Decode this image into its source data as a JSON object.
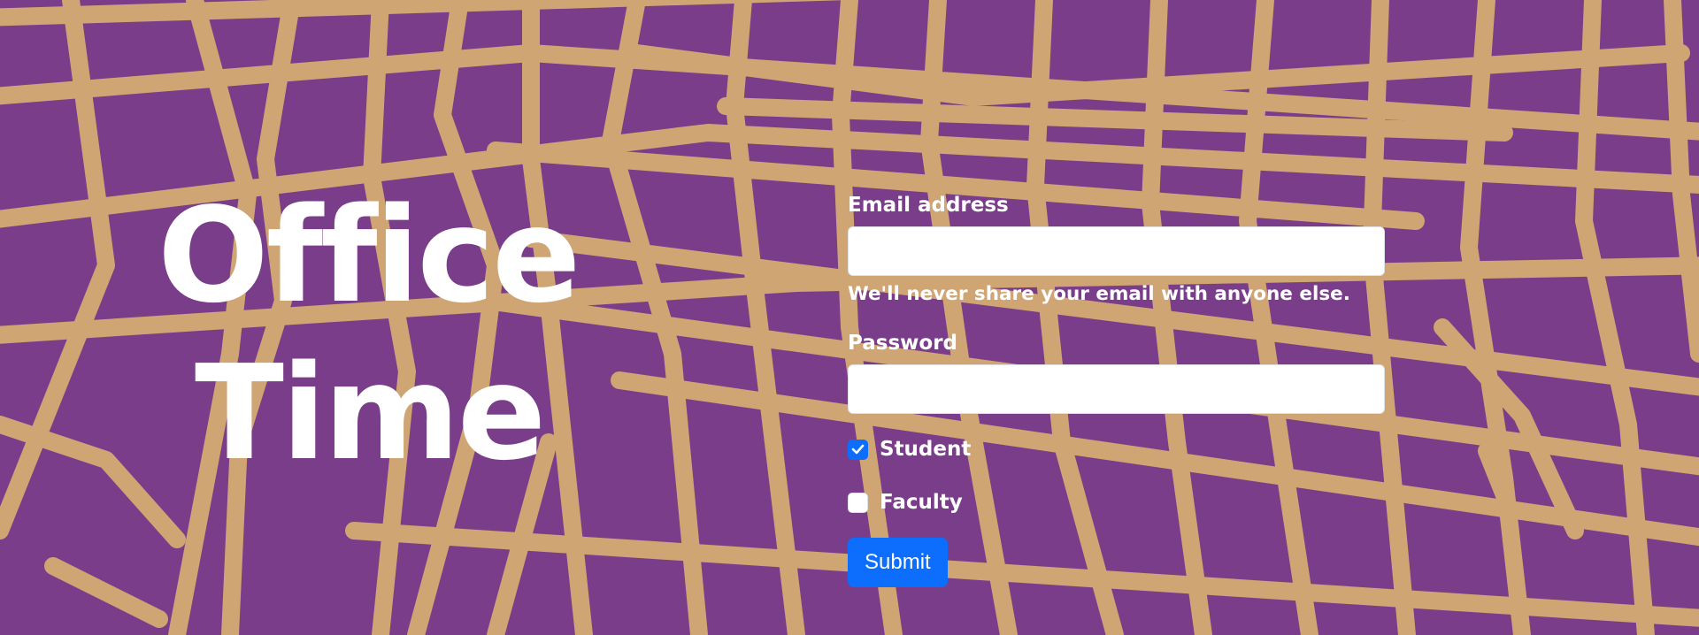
{
  "hero": {
    "title_line1": "Office",
    "title_line2": "Time"
  },
  "form": {
    "email_label": "Email address",
    "email_value": "",
    "email_help": "We'll never share your email with anyone else.",
    "password_label": "Password",
    "password_value": "",
    "options": [
      {
        "label": "Student",
        "checked": true
      },
      {
        "label": "Faculty",
        "checked": false
      }
    ],
    "submit_label": "Submit"
  },
  "colors": {
    "background": "#7a3d8a",
    "roads": "#cfa573",
    "accent": "#0d6efd",
    "text": "#ffffff"
  }
}
